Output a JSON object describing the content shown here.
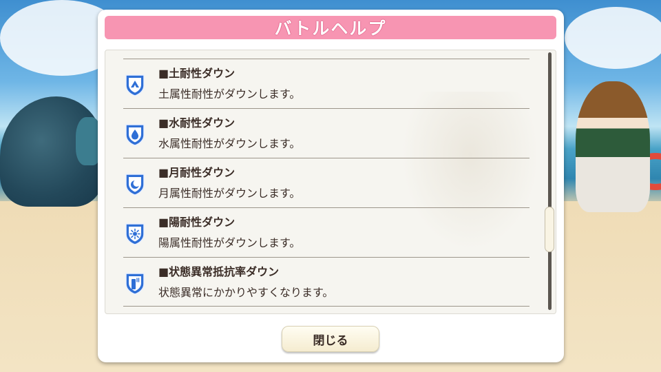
{
  "dialog": {
    "title": "バトルヘルプ",
    "close_label": "閉じる"
  },
  "help_items": [
    {
      "name": "■土耐性ダウン",
      "description": "土属性耐性がダウンします。",
      "icon": "earth-resistance-down-icon"
    },
    {
      "name": "■水耐性ダウン",
      "description": "水属性耐性がダウンします。",
      "icon": "water-resistance-down-icon"
    },
    {
      "name": "■月耐性ダウン",
      "description": "月属性耐性がダウンします。",
      "icon": "moon-resistance-down-icon"
    },
    {
      "name": "■陽耐性ダウン",
      "description": "陽属性耐性がダウンします。",
      "icon": "sun-resistance-down-icon"
    },
    {
      "name": "■状態異常抵抗率ダウン",
      "description": "状態異常にかかりやすくなります。",
      "icon": "status-resistance-down-icon"
    }
  ],
  "colors": {
    "title_bar": "#f795b2",
    "text": "#3b2d27",
    "icon_blue": "#2f6fd6"
  }
}
